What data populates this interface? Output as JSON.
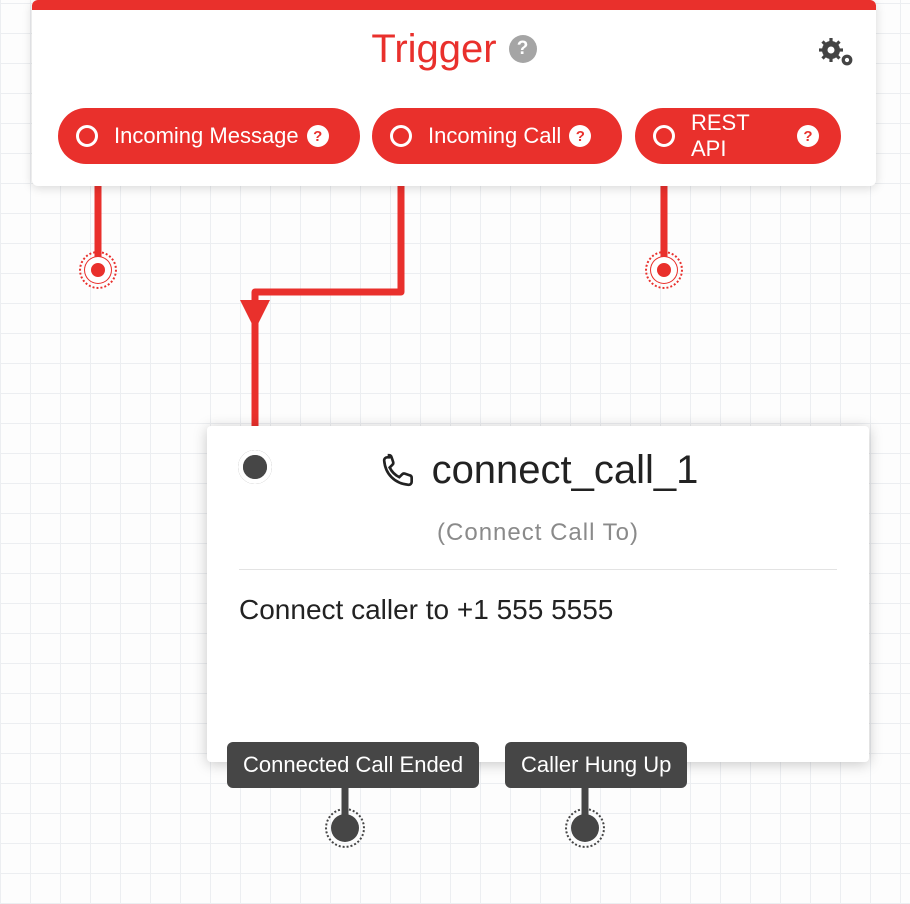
{
  "colors": {
    "accent": "#e9302c",
    "dark": "#464646"
  },
  "trigger": {
    "title": "Trigger",
    "outputs": [
      {
        "label": "Incoming Message"
      },
      {
        "label": "Incoming Call"
      },
      {
        "label": "REST API"
      }
    ]
  },
  "widget": {
    "name": "connect_call_1",
    "type_label": "(Connect Call To)",
    "description": "Connect caller to +1 555 5555",
    "outputs": [
      {
        "label": "Connected Call Ended"
      },
      {
        "label": "Caller Hung Up"
      }
    ]
  }
}
